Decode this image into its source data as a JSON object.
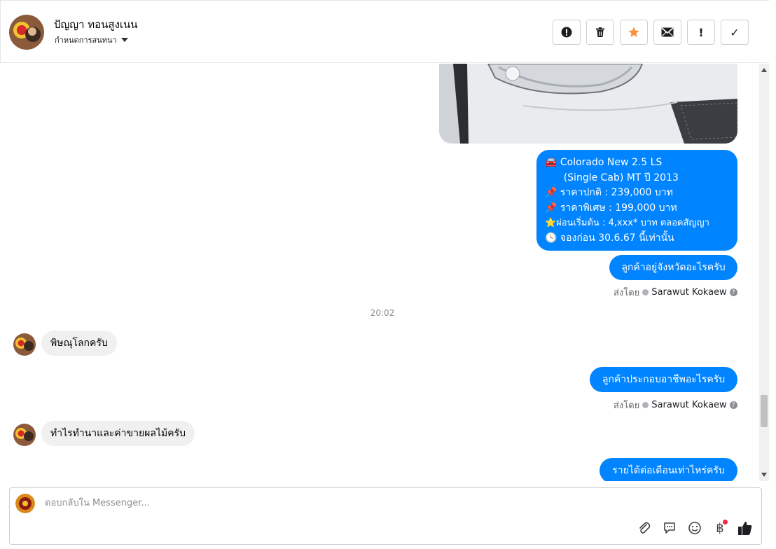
{
  "header": {
    "name": "ปัญญา ทอนสูงเนน",
    "subtitle": "กำหนดการสนทนา"
  },
  "toolbar": {
    "report_glyph": "!",
    "done_glyph": "✓",
    "warn_glyph": "!"
  },
  "messages": {
    "car_info_lines": [
      "🚘 Colorado New 2.5 LS",
      "      (Single Cab) MT ปี 2013",
      "📌 ราคาปกติ : 239,000 บาท",
      "📌 ราคาพิเศษ : 199,000 บาท",
      "⭐ผ่อนเริ่มต้น : 4,xxx* บาท ตลอดสัญญา",
      "🕓 จองก่อน 30.6.67 นี้เท่านั้น"
    ],
    "ask_province": "ลูกค้าอยู่จังหวัดอะไรครับ",
    "sent_by_label": "ส่งโดย",
    "agent_name": "Sarawut Kokaew",
    "timestamp": "20:02",
    "reply_province": "พิษณุโลกครับ",
    "ask_occupation": "ลูกค้าประกอบอาชีพอะไรครับ",
    "reply_occupation": "ทำไรทำนาและค่าขายผลไม้ครับ",
    "ask_income": "รายได้ต่อเดือนเท่าไหร่ครับ"
  },
  "composer": {
    "placeholder": "ตอบกลับใน Messenger...",
    "baht_symbol": "฿"
  },
  "colors": {
    "outgoing_bubble": "#0084ff",
    "incoming_bubble": "#f0f0f0",
    "star": "#f7923a"
  }
}
